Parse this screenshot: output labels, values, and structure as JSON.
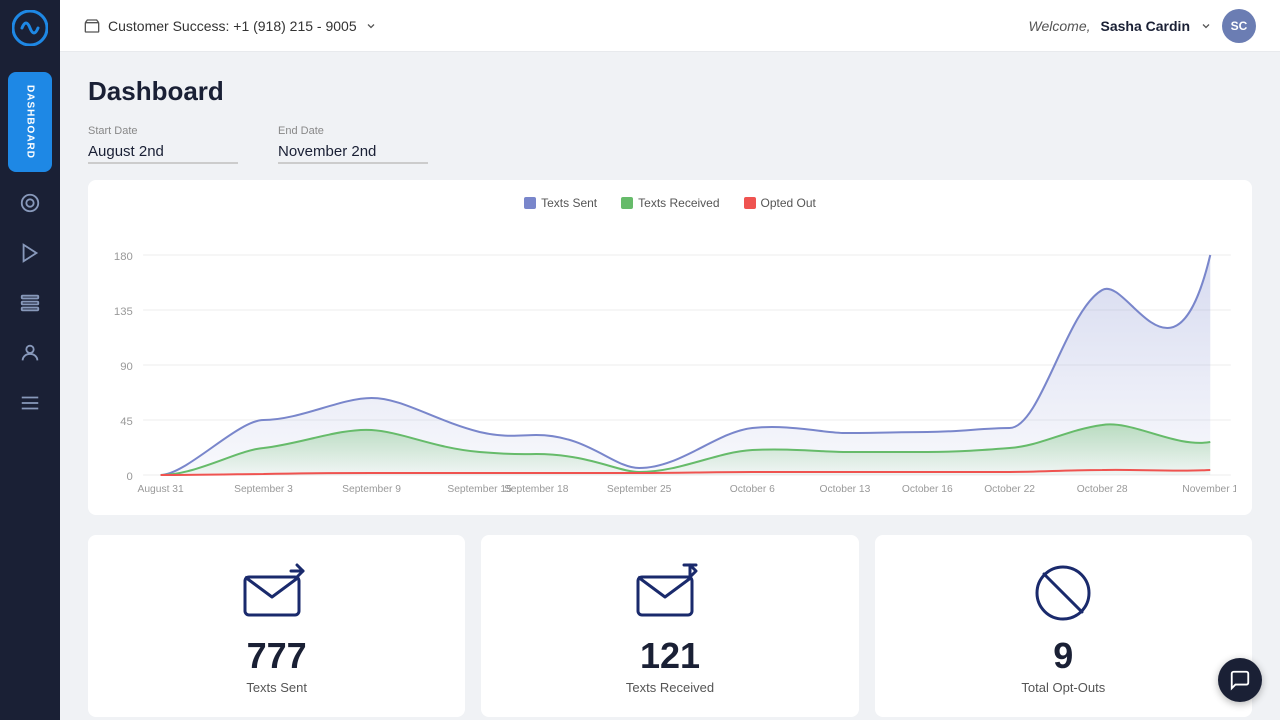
{
  "header": {
    "customer_success_label": "Customer Success: +1 (918) 215 - 9005",
    "welcome_text": "Welcome,",
    "user_name": "Sasha Cardin",
    "avatar_initials": "SC"
  },
  "sidebar": {
    "active_item": "Dashboard",
    "items": [
      {
        "label": "Dashboard",
        "icon": "⊞"
      },
      {
        "label": "Inbox",
        "icon": "◎"
      },
      {
        "label": "Campaigns",
        "icon": "▷"
      },
      {
        "label": "Sequences",
        "icon": "≡≡"
      },
      {
        "label": "Contacts",
        "icon": "👤"
      },
      {
        "label": "More",
        "icon": "≡"
      }
    ]
  },
  "page": {
    "title": "Dashboard"
  },
  "filters": {
    "start_date_label": "Start Date",
    "start_date_value": "August 2nd",
    "end_date_label": "End Date",
    "end_date_value": "November 2nd"
  },
  "chart": {
    "legend": [
      {
        "label": "Texts Sent",
        "color": "#7986cb"
      },
      {
        "label": "Texts Received",
        "color": "#66bb6a"
      },
      {
        "label": "Opted Out",
        "color": "#ef5350"
      }
    ],
    "x_labels": [
      "August 31",
      "September 3",
      "September 9",
      "September 15",
      "September 18",
      "September 25",
      "October 6",
      "October 13",
      "October 16",
      "October 22",
      "October 28",
      "November 1"
    ],
    "y_labels": [
      "0",
      "45",
      "90",
      "135",
      "180"
    ],
    "colors": {
      "sent": "#7986cb",
      "received": "#66bb6a",
      "optout": "#ef5350"
    }
  },
  "stats": [
    {
      "number": "777",
      "label": "Texts Sent",
      "icon_type": "sent"
    },
    {
      "number": "121",
      "label": "Texts Received",
      "icon_type": "received"
    },
    {
      "number": "9",
      "label": "Total Opt-Outs",
      "icon_type": "optout"
    }
  ]
}
